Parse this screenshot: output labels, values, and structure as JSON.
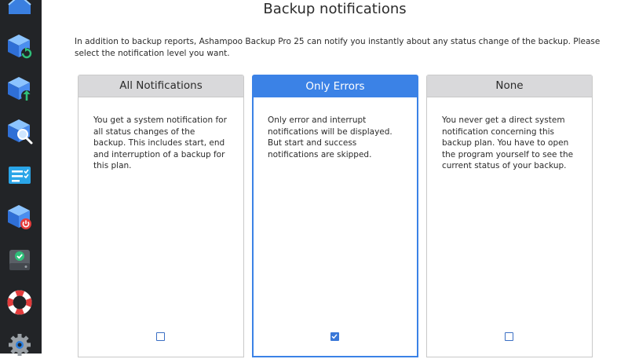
{
  "page": {
    "title": "Backup notifications",
    "intro": "In addition to backup reports, Ashampoo Backup Pro 25 can notify you instantly about any status change of the backup. Please select the notification level you want."
  },
  "sidebar": {
    "icons": [
      "home-icon",
      "restore-backup-icon",
      "upload-backup-icon",
      "inspect-backup-icon",
      "task-list-icon",
      "backup-power-icon",
      "drive-check-icon",
      "lifebuoy-icon",
      "settings-gear-icon"
    ]
  },
  "options": [
    {
      "title": "All Notifications",
      "description": "You get a system notification for all status changes of the backup. This includes start, end and interruption of a backup for this plan.",
      "checked": false
    },
    {
      "title": "Only Errors",
      "description": "Only error and interrupt notifications will be displayed. But start and success notifications are skipped.",
      "checked": true
    },
    {
      "title": "None",
      "description": "You never get a direct system notification concerning this backup plan. You have to open the program yourself to see the current status of your backup.",
      "checked": false
    }
  ],
  "colors": {
    "sidebar_bg": "#222427",
    "accent": "#3b82e6",
    "card_header": "#d9d9db"
  }
}
